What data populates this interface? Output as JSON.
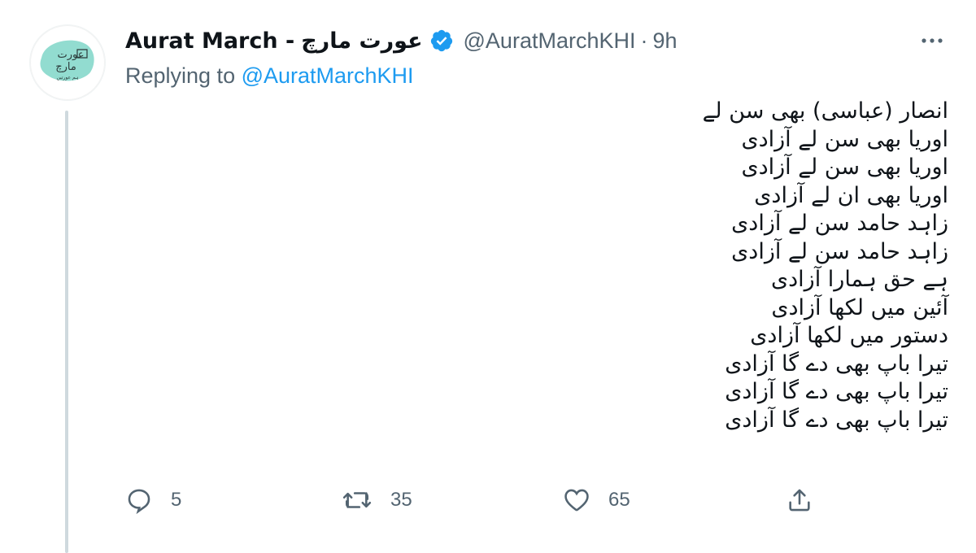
{
  "tweet": {
    "display_name": "Aurat March -",
    "display_name_urdu": "عورت مارچ",
    "verified": true,
    "handle": "@AuratMarchKHI",
    "separator": "·",
    "time": "9h",
    "replying_prefix": "Replying to ",
    "replying_to": "@AuratMarchKHI",
    "avatar": {
      "logo_line1": "عورت",
      "logo_line2": "مارچ",
      "logo_line3": "ہم عورتیں",
      "logo_color": "#7fd6c8"
    },
    "lines": [
      "انصار (عباسی) بھی سن لے",
      "اوریا بھی سن لے آزادی",
      "اوریا بھی سن لے آزادی",
      "اوریا بھی ان لے آزادی",
      "زاہد حامد سن لے آزادی",
      "زاہد حامد سن لے  آزادی",
      "ہے حق ہمارا آزادی",
      "آئین میں لکھا آزادی",
      "دستور میں لکھا آزادی",
      "تیرا باپ بھی دے گا آزادی",
      "تیرا باپ بھی دے گا آزادی",
      "تیرا باپ بھی دے گا آزادی"
    ]
  },
  "actions": {
    "reply_count": "5",
    "retweet_count": "35",
    "like_count": "65",
    "icons": [
      "reply-icon",
      "retweet-icon",
      "like-icon",
      "share-icon"
    ]
  },
  "colors": {
    "text": "#0f1419",
    "secondary": "#536471",
    "accent": "#1d9bf0",
    "thread_line": "#cfd9de"
  }
}
